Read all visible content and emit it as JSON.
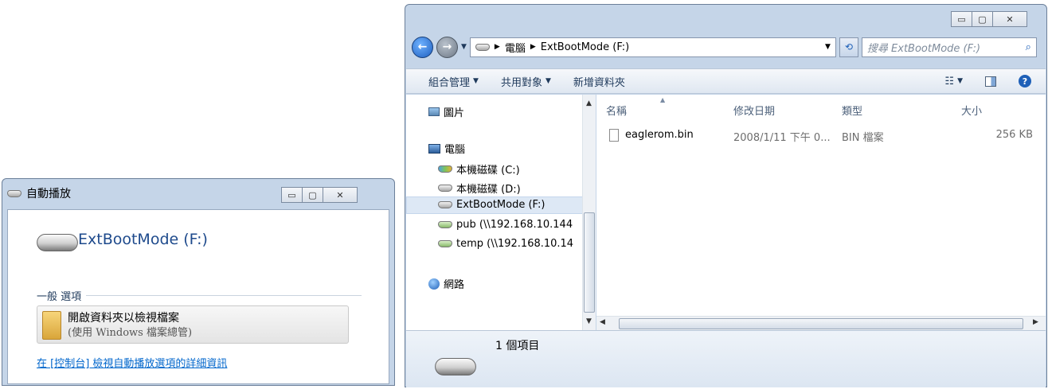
{
  "autoplay": {
    "title": "自動播放",
    "drive_name": "ExtBootMode (F:)",
    "section_label": "一般 選項",
    "option_title": "開啟資料夾以檢視檔案",
    "option_sub": "(使用 Windows 檔案總管)",
    "control_panel_link": "在 [控制台] 檢視自動播放選項的詳細資訊"
  },
  "explorer": {
    "breadcrumb": [
      "電腦",
      "ExtBootMode (F:)"
    ],
    "search_placeholder": "搜尋 ExtBootMode (F:)",
    "toolbar": {
      "organize": "組合管理",
      "share": "共用對象",
      "new_folder": "新增資料夾"
    },
    "nav": {
      "pictures": "圖片",
      "computer": "電腦",
      "drive_c": "本機磁碟 (C:)",
      "drive_d": "本機磁碟 (D:)",
      "drive_f": "ExtBootMode (F:)",
      "pub": "pub (\\\\192.168.10.144",
      "temp": "temp (\\\\192.168.10.14",
      "network": "網路"
    },
    "columns": {
      "name": "名稱",
      "date": "修改日期",
      "type": "類型",
      "size": "大小"
    },
    "files": [
      {
        "name": "eaglerom.bin",
        "date": "2008/1/11 下午 0...",
        "type": "BIN 檔案",
        "size": "256 KB"
      }
    ],
    "status": "1 個項目"
  },
  "colors": {
    "frame": "#c5d5e8",
    "link": "#0066cc",
    "selected": "#dde8f5"
  }
}
